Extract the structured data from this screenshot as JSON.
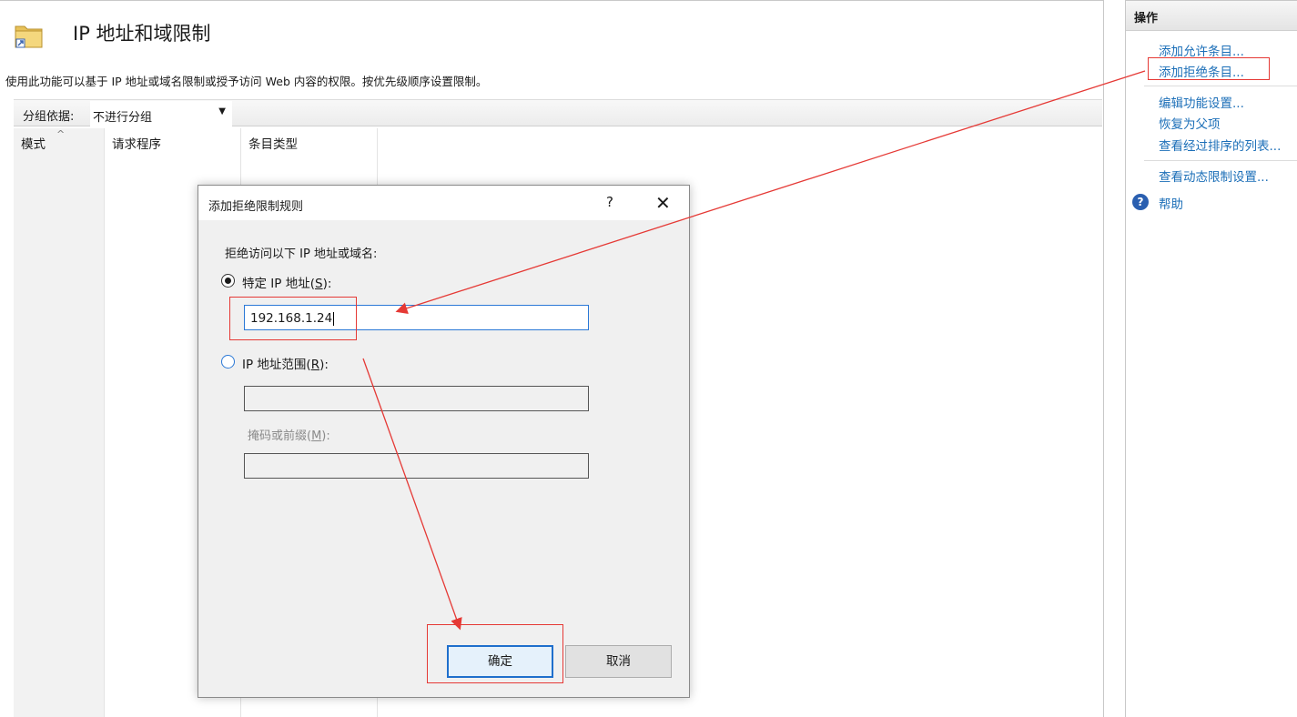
{
  "page": {
    "title": "IP 地址和域限制",
    "description": "使用此功能可以基于 IP 地址或域名限制或授予访问 Web 内容的权限。按优先级顺序设置限制。"
  },
  "group_bar": {
    "label": "分组依据:",
    "selected": "不进行分组"
  },
  "list": {
    "columns": [
      "模式",
      "请求程序",
      "条目类型"
    ]
  },
  "actions": {
    "header": "操作",
    "items": [
      "添加允许条目...",
      "添加拒绝条目...",
      "编辑功能设置...",
      "恢复为父项",
      "查看经过排序的列表...",
      "查看动态限制设置..."
    ],
    "help": "帮助"
  },
  "dialog": {
    "title": "添加拒绝限制规则",
    "help_glyph": "?",
    "close_glyph": "✕",
    "prompt": "拒绝访问以下 IP 地址或域名:",
    "specific_ip": {
      "label_prefix": "特定 IP 地址(",
      "accel": "S",
      "label_suffix": "):",
      "value": "192.168.1.24"
    },
    "ip_range": {
      "label_prefix": "IP 地址范围(",
      "accel": "R",
      "label_suffix": "):"
    },
    "mask": {
      "label_prefix": "掩码或前缀(",
      "accel": "M",
      "label_suffix": "):"
    },
    "ok": "确定",
    "cancel": "取消"
  },
  "colors": {
    "link": "#1c6fb8",
    "annotation": "#e53935",
    "accent": "#1f6fcc"
  }
}
